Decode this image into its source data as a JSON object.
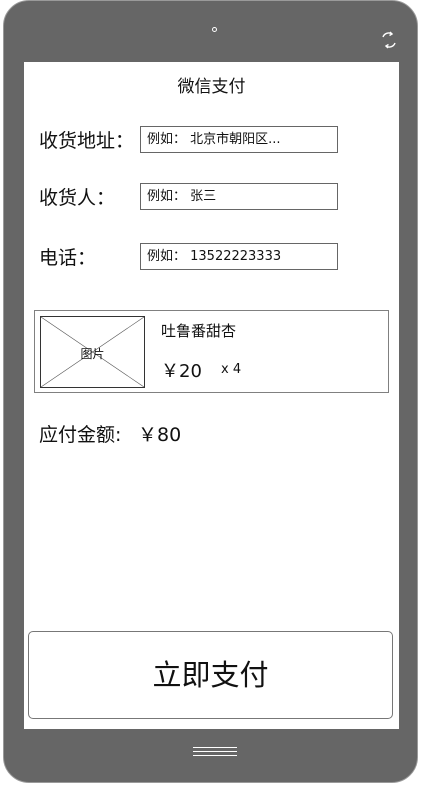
{
  "header": {
    "title": "微信支付"
  },
  "form": {
    "address_label": "收货地址：",
    "address_placeholder": "例如： 北京市朝阳区...",
    "receiver_label": "收货人：",
    "receiver_placeholder": "例如： 张三",
    "phone_label": "电话：",
    "phone_placeholder": "例如： 13522223333"
  },
  "product": {
    "image_label": "图片",
    "name": "吐鲁番甜杏",
    "price": "￥20",
    "quantity": "x 4"
  },
  "total": {
    "label": "应付金额:",
    "value": "￥80"
  },
  "actions": {
    "pay_label": "立即支付"
  },
  "icons": {
    "rotate": "rotate-icon",
    "camera": "camera-icon",
    "home": "home-menu-icon"
  },
  "colors": {
    "phone_frame": "#666666",
    "screen": "#ffffff",
    "border": "#666666"
  }
}
